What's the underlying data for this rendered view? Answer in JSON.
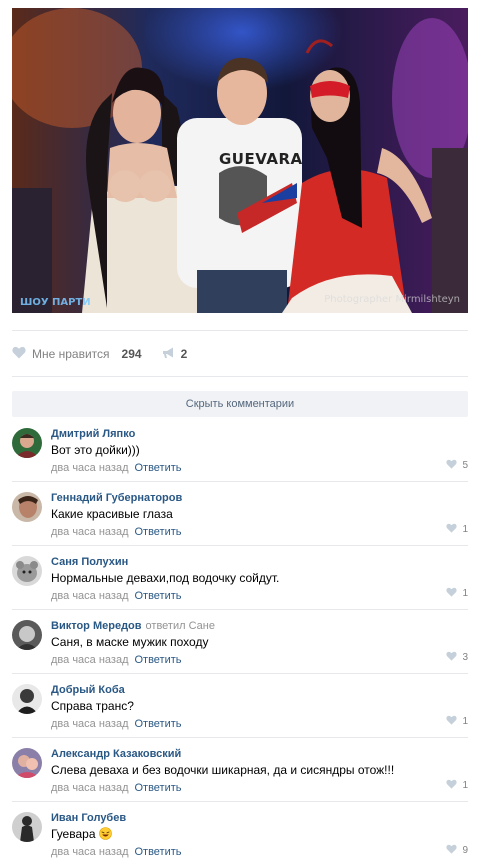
{
  "photo": {
    "shirt_text": "GUEVARA",
    "watermark_left": "ШОУ ПАРТИ",
    "watermark_right": "Photographer Mirmilshteyn"
  },
  "post_actions": {
    "like_label": "Мне нравится",
    "like_count": "294",
    "repost_count": "2"
  },
  "hide_comments_label": "Скрыть комментарии",
  "comments": [
    {
      "author": "Дмитрий Ляпко",
      "reply_to": "",
      "text": "Вот это дойки)))",
      "time": "два часа назад",
      "reply_label": "Ответить",
      "likes": "5"
    },
    {
      "author": "Геннадий Губернаторов",
      "reply_to": "",
      "text": "Какие красивые глаза",
      "time": "два часа назад",
      "reply_label": "Ответить",
      "likes": "1"
    },
    {
      "author": "Саня Полухин",
      "reply_to": "",
      "text": "Нормальные девахи,под водочку сойдут.",
      "time": "два часа назад",
      "reply_label": "Ответить",
      "likes": "1"
    },
    {
      "author": "Виктор Мередов",
      "reply_to": "ответил Сане",
      "text": "Саня, в маске мужик походу",
      "time": "два часа назад",
      "reply_label": "Ответить",
      "likes": "3"
    },
    {
      "author": "Добрый Коба",
      "reply_to": "",
      "text": "Справа транс?",
      "time": "два часа назад",
      "reply_label": "Ответить",
      "likes": "1"
    },
    {
      "author": "Александр Казаковский",
      "reply_to": "",
      "text": "Слева деваха и без водочки шикарная, да и сисяндры отож!!!",
      "time": "два часа назад",
      "reply_label": "Ответить",
      "likes": "1"
    },
    {
      "author": "Иван Голубев",
      "reply_to": "",
      "text": "Гуевара",
      "time": "два часа назад",
      "reply_label": "Ответить",
      "likes": "9"
    }
  ],
  "colors": {
    "link": "#2a5885",
    "meta": "#939393",
    "bar": "#f0f2f5"
  }
}
